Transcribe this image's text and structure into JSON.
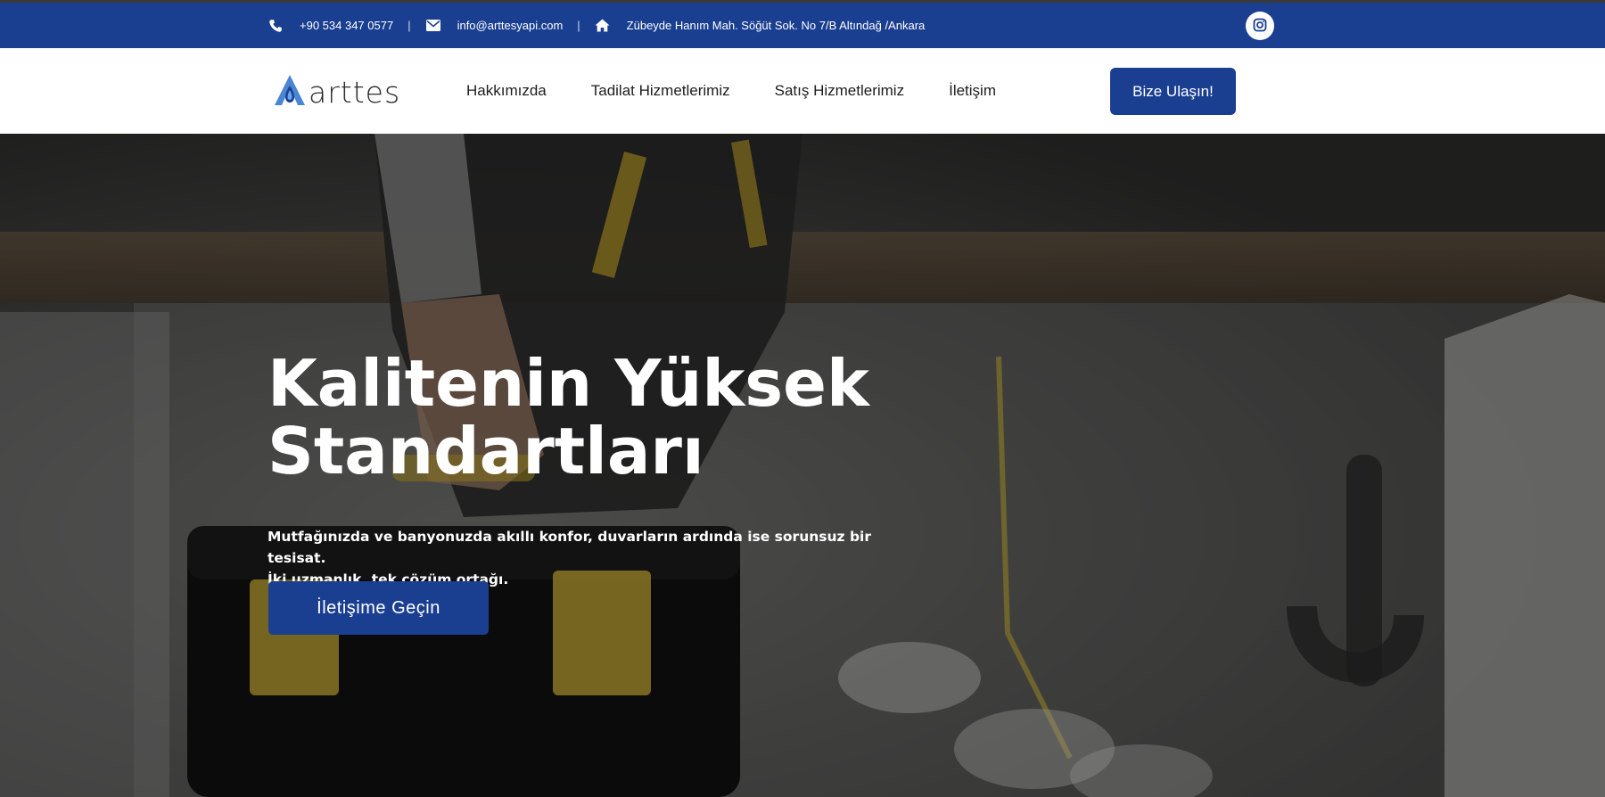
{
  "topbar": {
    "phone": "+90 534 347 0577",
    "email": "info@arttesyapi.com",
    "address": "Zübeyde Hanım Mah. Söğüt Sok. No 7/B Altındağ /Ankara",
    "separator": "|",
    "icons": [
      "phone-icon",
      "envelope-icon",
      "home-icon",
      "instagram-icon"
    ]
  },
  "nav": {
    "logo_text": "arttes",
    "menu": [
      {
        "label": "Hakkımızda"
      },
      {
        "label": "Tadilat Hizmetlerimiz"
      },
      {
        "label": "Satış Hizmetlerimiz"
      },
      {
        "label": "İletişim"
      }
    ],
    "cta_label": "Bize Ulaşın!"
  },
  "hero": {
    "title_line1": "Kalitenin Yüksek",
    "title_line2": "Standartları",
    "subtitle_line1": "Mutfağınızda ve banyonuzda akıllı konfor, duvarların ardında ise sorunsuz bir tesisat.",
    "subtitle_line2": "İki uzmanlık, tek çözüm ortağı.",
    "button_label": "İletişime Geçin"
  },
  "colors": {
    "brand_blue": "#1a3f91",
    "white": "#ffffff",
    "text_dark": "#1d1d1d"
  }
}
